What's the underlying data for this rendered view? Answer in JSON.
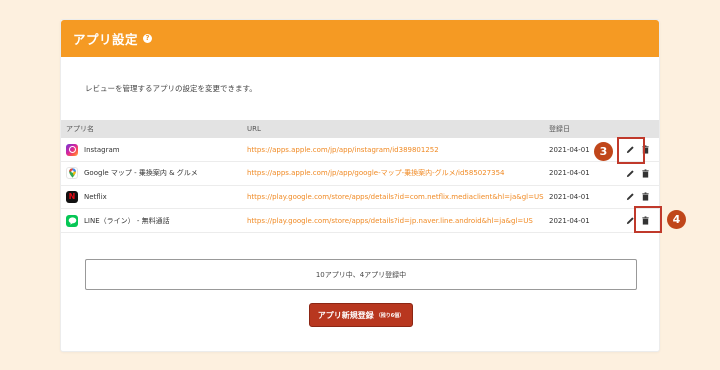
{
  "header": {
    "title": "アプリ設定",
    "help_glyph": "?"
  },
  "description": "レビューを管理するアプリの設定を変更できます。",
  "table": {
    "columns": [
      "アプリ名",
      "URL",
      "登録日",
      ""
    ],
    "rows": [
      {
        "icon": "instagram-icon",
        "name": "Instagram",
        "url": "https://apps.apple.com/jp/app/instagram/id389801252",
        "date": "2021-04-01"
      },
      {
        "icon": "google-maps-icon",
        "name": "Google マップ - 乗換案内 & グルメ",
        "url": "https://apps.apple.com/jp/app/google-マップ-乗換案内-グルメ/id585027354",
        "date": "2021-04-01"
      },
      {
        "icon": "netflix-icon",
        "name": "Netflix",
        "url": "https://play.google.com/store/apps/details?id=com.netflix.mediaclient&hl=ja&gl=US",
        "date": "2021-04-01"
      },
      {
        "icon": "line-icon",
        "name": "LINE（ライン） - 無料通話",
        "url": "https://play.google.com/store/apps/details?id=jp.naver.line.android&hl=ja&gl=US",
        "date": "2021-04-01"
      }
    ]
  },
  "quota": "10アプリ中、4アプリ登録中",
  "add_button": {
    "label": "アプリ新規登録",
    "sub": "（残り6個）"
  },
  "annotations": {
    "edit_marker": "3",
    "delete_marker": "4"
  },
  "colors": {
    "accent": "#f59a23",
    "link": "#f08a24",
    "button": "#b8371f",
    "marker": "#c0461a",
    "background": "#fdf0df"
  }
}
